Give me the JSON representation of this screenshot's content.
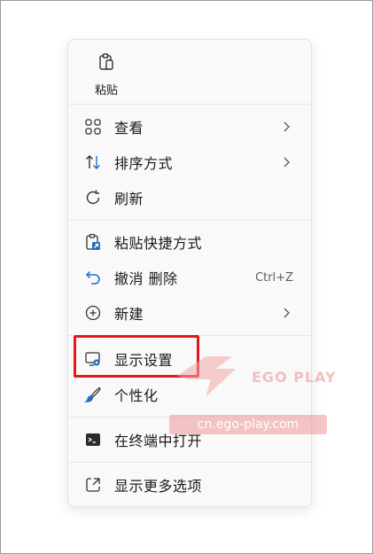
{
  "menu": {
    "paste": {
      "label": "粘贴",
      "icon": "clipboard-icon"
    },
    "items": [
      {
        "label": "查看",
        "icon": "view-grid-icon",
        "submenu": true
      },
      {
        "label": "排序方式",
        "icon": "sort-arrows-icon",
        "submenu": true
      },
      {
        "label": "刷新",
        "icon": "refresh-icon",
        "submenu": false
      },
      {
        "label": "粘贴快捷方式",
        "icon": "paste-shortcut-icon",
        "submenu": false
      },
      {
        "label": "撤消 删除",
        "icon": "undo-icon",
        "shortcut": "Ctrl+Z"
      },
      {
        "label": "新建",
        "icon": "new-plus-icon",
        "submenu": true
      },
      {
        "label": "显示设置",
        "icon": "display-settings-icon",
        "highlighted": true
      },
      {
        "label": "个性化",
        "icon": "brush-icon",
        "submenu": false
      },
      {
        "label": "在终端中打开",
        "icon": "terminal-icon",
        "submenu": false
      },
      {
        "label": "显示更多选项",
        "icon": "more-options-icon",
        "submenu": false
      }
    ]
  },
  "watermark": {
    "brand": "EGO PLAY",
    "url": "cn.ego-play.com"
  },
  "colors": {
    "highlight_border": "#e5161c",
    "menu_bg": "#f9f9f9",
    "icon_blue": "#1f6fc5"
  }
}
